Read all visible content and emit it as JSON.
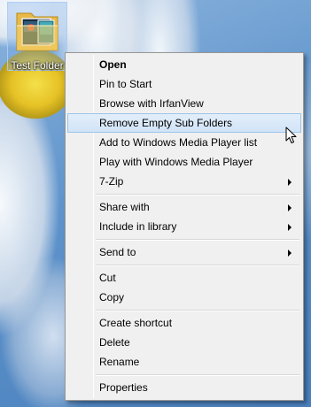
{
  "desktop": {
    "icon": {
      "label": "Test Folder",
      "icon_name": "folder-icon"
    },
    "wallpaper_accent": "#5e93cb"
  },
  "context_menu": {
    "highlight_color": "#d1e4f7",
    "items": [
      {
        "label": "Open",
        "bold": true
      },
      {
        "label": "Pin to Start"
      },
      {
        "label": "Browse with IrfanView"
      },
      {
        "label": "Remove Empty Sub Folders",
        "highlighted": true
      },
      {
        "label": "Add to Windows Media Player list"
      },
      {
        "label": "Play with Windows Media Player"
      },
      {
        "label": "7-Zip",
        "submenu": true
      },
      {
        "label": "Share with",
        "submenu": true
      },
      {
        "label": "Include in library",
        "submenu": true
      },
      {
        "label": "Send to",
        "submenu": true
      },
      {
        "label": "Cut"
      },
      {
        "label": "Copy"
      },
      {
        "label": "Create shortcut"
      },
      {
        "label": "Delete"
      },
      {
        "label": "Rename"
      },
      {
        "label": "Properties"
      }
    ]
  },
  "cursor": {
    "icon_name": "arrow-cursor-icon"
  }
}
